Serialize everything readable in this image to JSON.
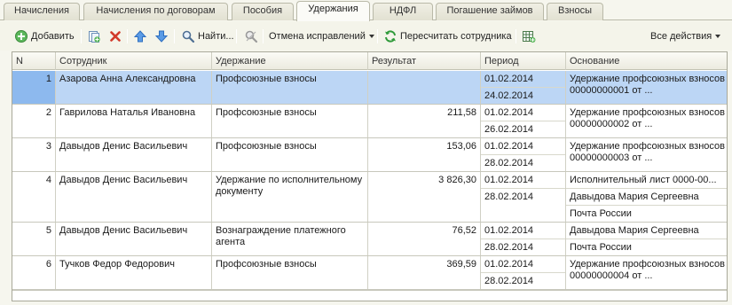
{
  "tabs": [
    {
      "label": "Начисления",
      "active": false
    },
    {
      "label": "Начисления по договорам",
      "active": false
    },
    {
      "label": "Пособия",
      "active": false
    },
    {
      "label": "Удержания",
      "active": true
    },
    {
      "label": "НДФЛ",
      "active": false
    },
    {
      "label": "Погашение займов",
      "active": false
    },
    {
      "label": "Взносы",
      "active": false
    }
  ],
  "toolbar": {
    "add_label": "Добавить",
    "find_label": "Найти...",
    "cancel_corrections_label": "Отмена исправлений",
    "recalc_label": "Пересчитать сотрудника",
    "all_actions_label": "Все действия"
  },
  "table": {
    "columns": [
      "N",
      "Сотрудник",
      "Удержание",
      "Результат",
      "Период",
      "Основание"
    ],
    "rows": [
      {
        "n": "1",
        "employee": "Азарова Анна Александровна",
        "deduction": "Профсоюзные взносы",
        "result": "",
        "period_from": "01.02.2014",
        "period_to": "24.02.2014",
        "basis": [
          "Удержание профсоюзных взносов 00000000001 от ..."
        ],
        "selected": true
      },
      {
        "n": "2",
        "employee": "Гаврилова Наталья Ивановна",
        "deduction": "Профсоюзные взносы",
        "result": "211,58",
        "period_from": "01.02.2014",
        "period_to": "26.02.2014",
        "basis": [
          "Удержание профсоюзных взносов 00000000002 от ..."
        ],
        "selected": false
      },
      {
        "n": "3",
        "employee": "Давыдов Денис Васильевич",
        "deduction": "Профсоюзные взносы",
        "result": "153,06",
        "period_from": "01.02.2014",
        "period_to": "28.02.2014",
        "basis": [
          "Удержание профсоюзных взносов 00000000003 от ..."
        ],
        "selected": false
      },
      {
        "n": "4",
        "employee": "Давыдов Денис Васильевич",
        "deduction": "Удержание по исполнительному документу",
        "result": "3 826,30",
        "period_from": "01.02.2014",
        "period_to": "28.02.2014",
        "basis": [
          "Исполнительный лист 0000-00...",
          "Давыдова Мария Сергеевна",
          "Почта России"
        ],
        "selected": false
      },
      {
        "n": "5",
        "employee": "Давыдов Денис Васильевич",
        "deduction": "Вознаграждение платежного агента",
        "result": "76,52",
        "period_from": "01.02.2014",
        "period_to": "28.02.2014",
        "basis": [
          "Давыдова Мария Сергеевна",
          "Почта России"
        ],
        "selected": false
      },
      {
        "n": "6",
        "employee": "Тучков Федор Федорович",
        "deduction": "Профсоюзные взносы",
        "result": "369,59",
        "period_from": "01.02.2014",
        "period_to": "28.02.2014",
        "basis": [
          "Удержание профсоюзных взносов 00000000004 от ..."
        ],
        "selected": false
      }
    ]
  },
  "colors": {
    "selected_row": "#bcd6f5",
    "selected_number_cell": "#8db9ee",
    "delete_icon": "#d23a2a",
    "arrow_icon": "#3d7fd6",
    "recalc_icon": "#2f9a3a"
  },
  "icons": [
    "add-icon",
    "copy-icon",
    "delete-icon",
    "move-up-icon",
    "move-down-icon",
    "find-icon",
    "cancel-search-icon",
    "recalc-icon",
    "table-settings-icon"
  ]
}
